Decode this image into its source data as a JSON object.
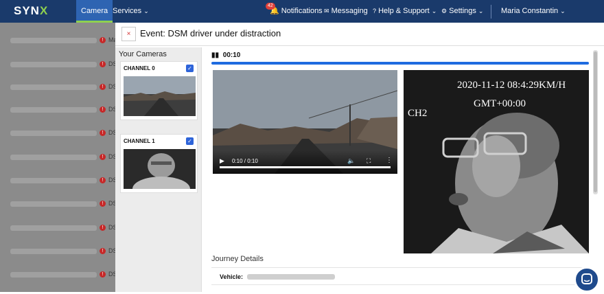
{
  "nav": {
    "logo_a": "SYN",
    "logo_b": "X",
    "tabs": [
      {
        "label": "Camera"
      },
      {
        "label": "Services"
      }
    ],
    "notifications_label": "Notifications",
    "notifications_count": "42",
    "messaging_label": "Messaging",
    "help_label": "Help & Support",
    "settings_label": "Settings",
    "user_name": "Maria Constantin"
  },
  "background_list": {
    "rows": [
      {
        "suffix": "Ma"
      },
      {
        "suffix": "DS"
      },
      {
        "suffix": "DS"
      },
      {
        "suffix": "DS"
      },
      {
        "suffix": "DS"
      },
      {
        "suffix": "DS"
      },
      {
        "suffix": "DS"
      },
      {
        "suffix": "DS"
      },
      {
        "suffix": "DS"
      },
      {
        "suffix": "DS"
      },
      {
        "suffix": "DS"
      }
    ]
  },
  "modal": {
    "title": "Event: DSM driver under distraction",
    "close_icon": "×",
    "cameras_title": "Your Cameras",
    "cameras": [
      {
        "label": "CHANNEL 0",
        "checked": true
      },
      {
        "label": "CHANNEL 1",
        "checked": true
      }
    ],
    "player": {
      "time": "00:10",
      "progress": 1.0
    },
    "video1": {
      "time": "0:10 / 0:10"
    },
    "video2": {
      "overlay_date": "2020-11-12 08:4:29KM/H",
      "overlay_tz": "GMT+00:00",
      "overlay_channel": "CH2"
    },
    "journey_title": "Journey Details",
    "vehicle_label": "Vehicle:"
  },
  "colors": {
    "navbar": "#1a3a6b",
    "accent": "#8fd14f",
    "progress": "#1e6be0",
    "error": "#c62828"
  }
}
